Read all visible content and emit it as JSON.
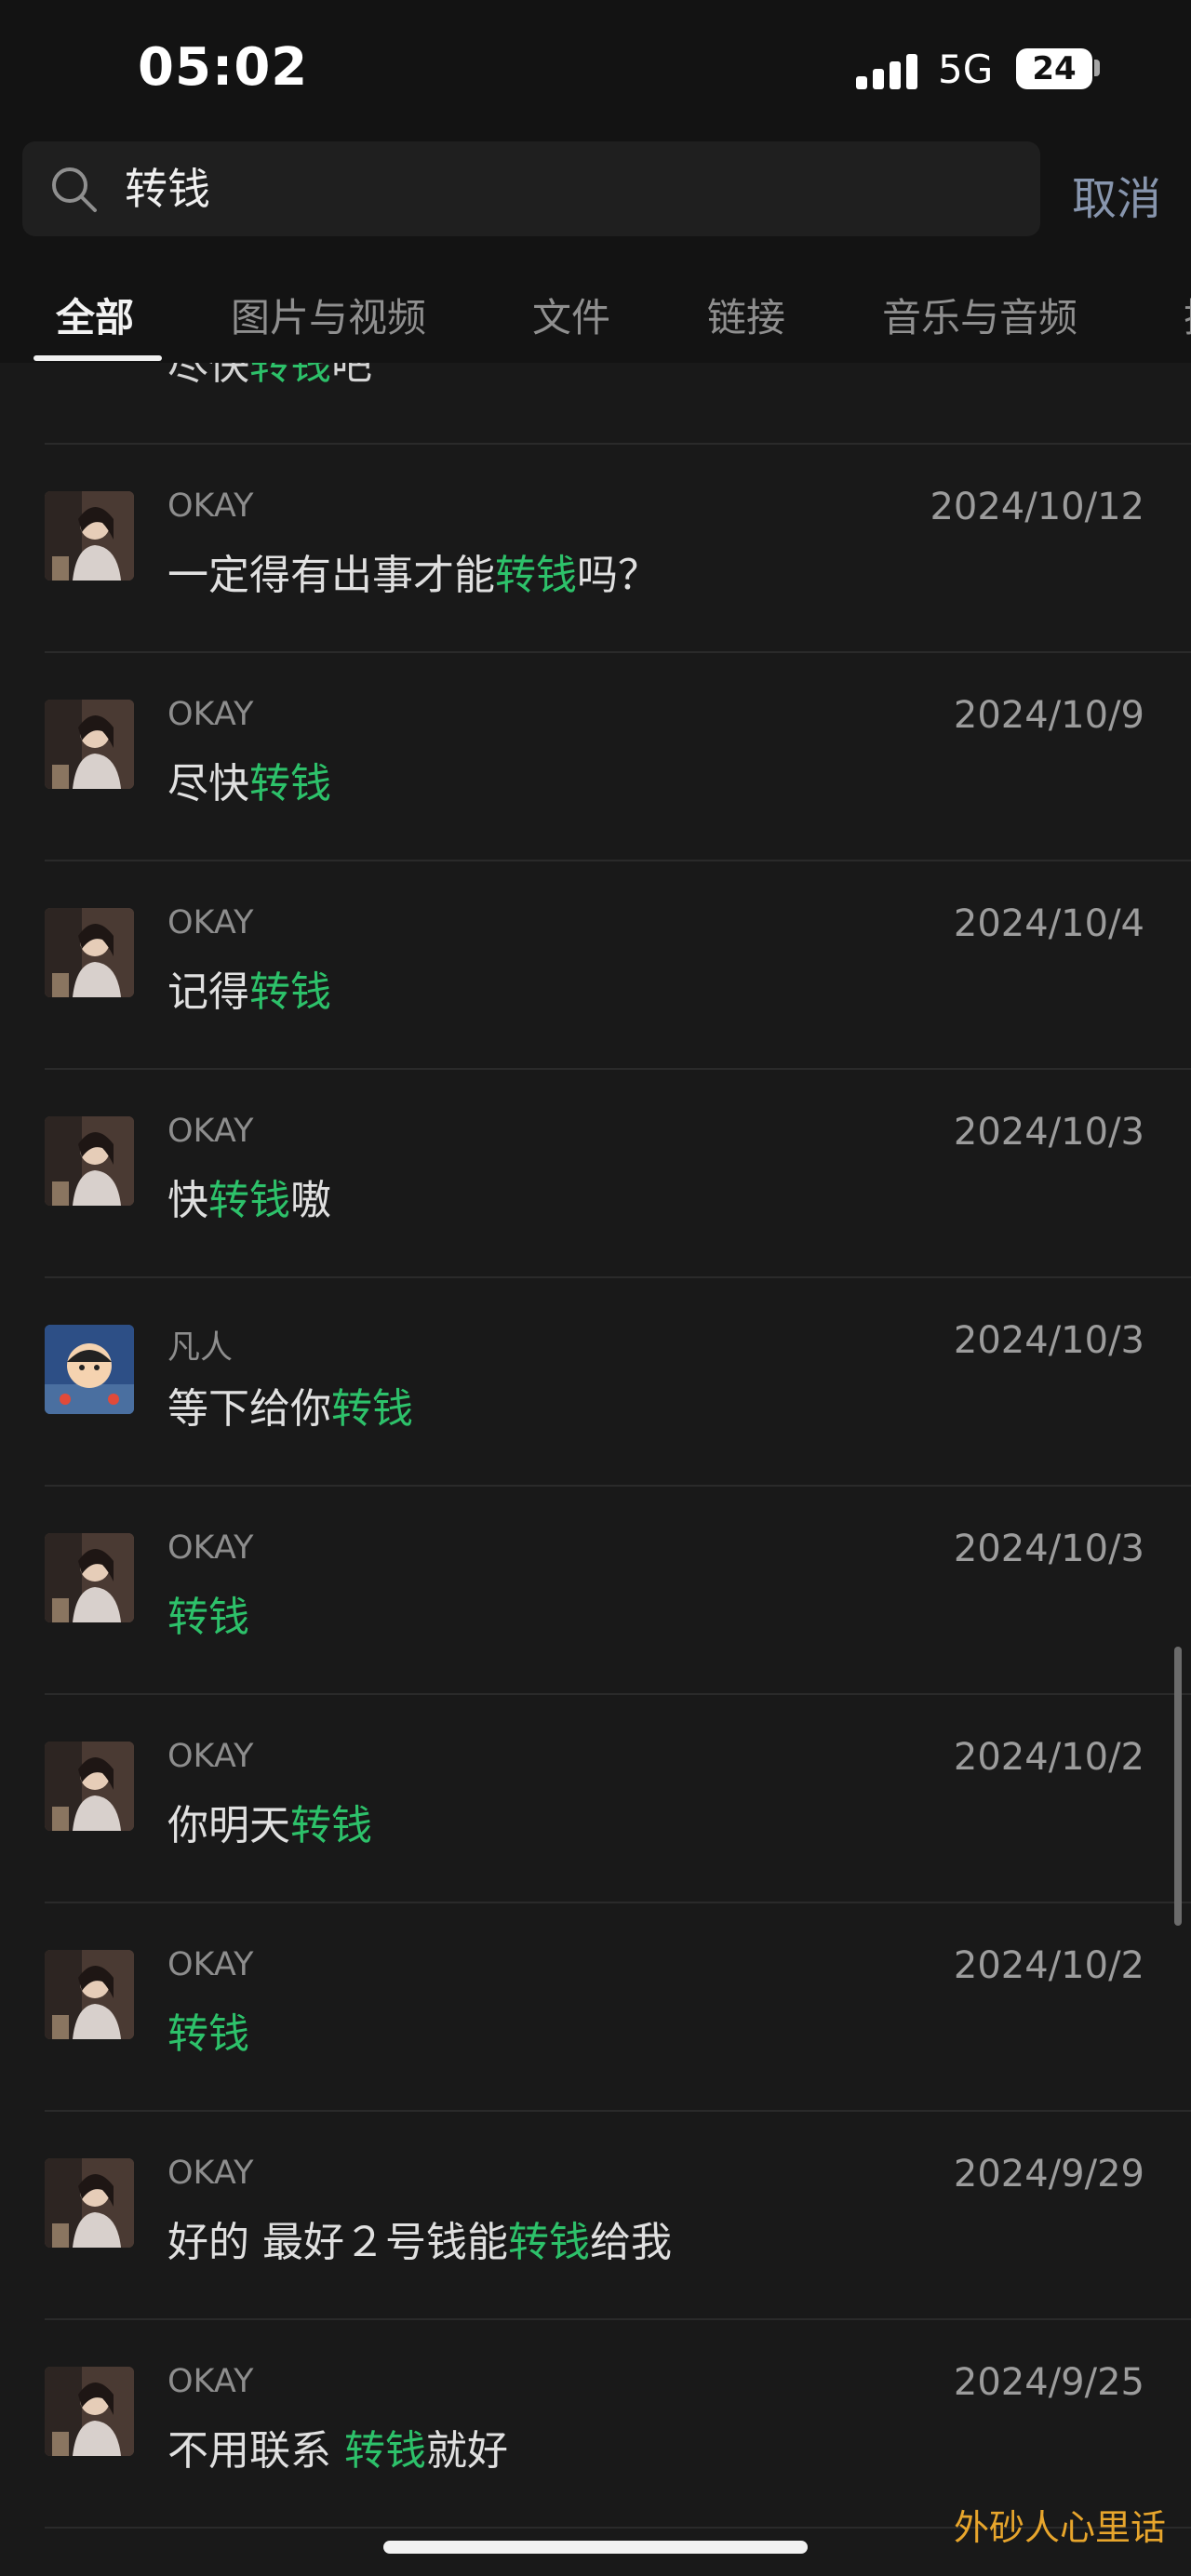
{
  "status_bar": {
    "time": "05:02",
    "network": "5G",
    "battery": "24"
  },
  "search": {
    "query": "转钱",
    "cancel_label": "取消"
  },
  "tabs": [
    "全部",
    "图片与视频",
    "文件",
    "链接",
    "音乐与音频",
    "搜"
  ],
  "partial_top_message": [
    "尽快",
    "转钱",
    "吧"
  ],
  "results": [
    {
      "sender": "OKAY",
      "date": "2024/10/12",
      "parts": [
        "一定得有出事才能",
        "转钱",
        "吗？"
      ],
      "avatar": "avatar-okay"
    },
    {
      "sender": "OKAY",
      "date": "2024/10/9",
      "parts": [
        "尽快",
        "转钱",
        ""
      ],
      "avatar": "avatar-okay"
    },
    {
      "sender": "OKAY",
      "date": "2024/10/4",
      "parts": [
        "记得",
        "转钱",
        ""
      ],
      "avatar": "avatar-okay"
    },
    {
      "sender": "OKAY",
      "date": "2024/10/3",
      "parts": [
        "快",
        "转钱",
        "嗷"
      ],
      "avatar": "avatar-okay"
    },
    {
      "sender": "凡人",
      "date": "2024/10/3",
      "parts": [
        "等下给你",
        "转钱",
        ""
      ],
      "avatar": "avatar-cartoon"
    },
    {
      "sender": "OKAY",
      "date": "2024/10/3",
      "parts": [
        "",
        "转钱",
        ""
      ],
      "avatar": "avatar-okay"
    },
    {
      "sender": "OKAY",
      "date": "2024/10/2",
      "parts": [
        "你明天",
        "转钱",
        ""
      ],
      "avatar": "avatar-okay"
    },
    {
      "sender": "OKAY",
      "date": "2024/10/2",
      "parts": [
        "",
        "转钱",
        ""
      ],
      "avatar": "avatar-okay"
    },
    {
      "sender": "OKAY",
      "date": "2024/9/29",
      "parts": [
        "好的 最好２号钱能",
        "转钱",
        "给我"
      ],
      "avatar": "avatar-okay"
    },
    {
      "sender": "OKAY",
      "date": "2024/9/25",
      "parts": [
        "不用联系 ",
        "转钱",
        "就好"
      ],
      "avatar": "avatar-okay"
    }
  ],
  "watermark": "外砂人心里话",
  "colors": {
    "background": "#191919",
    "highlight": "#2dc16a",
    "cancel": "#8795ad",
    "watermark": "#e7a52c"
  }
}
